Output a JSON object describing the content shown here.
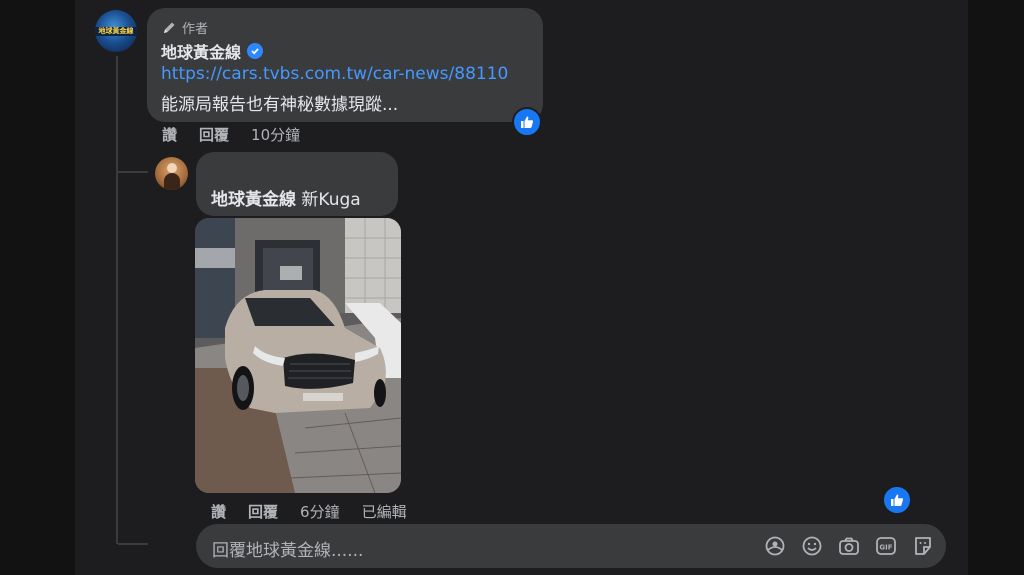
{
  "comment": {
    "author_badge": "作者",
    "author_name": "地球黃金線",
    "link": "https://cars.tvbs.com.tw/car-news/88110",
    "text": "能源局報告也有神秘數據現蹤...",
    "actions": {
      "like": "讚",
      "reply": "回覆",
      "time": "10分鐘"
    }
  },
  "reply": {
    "mention": "地球黃金線",
    "text": "新Kuga",
    "photo_alt": "銀色 Ford Kuga 停在展示中心前",
    "actions": {
      "like": "讚",
      "reply": "回覆",
      "time": "6分鐘",
      "edited": "已編輯"
    }
  },
  "composer": {
    "placeholder": "回覆地球黃金線......",
    "tools": [
      "sticker-avatar-icon",
      "emoji-icon",
      "camera-icon",
      "gif-icon",
      "sticker-icon"
    ]
  },
  "colors": {
    "link": "#4599ff",
    "like": "#1877f2",
    "bubble": "#3a3b3c"
  }
}
